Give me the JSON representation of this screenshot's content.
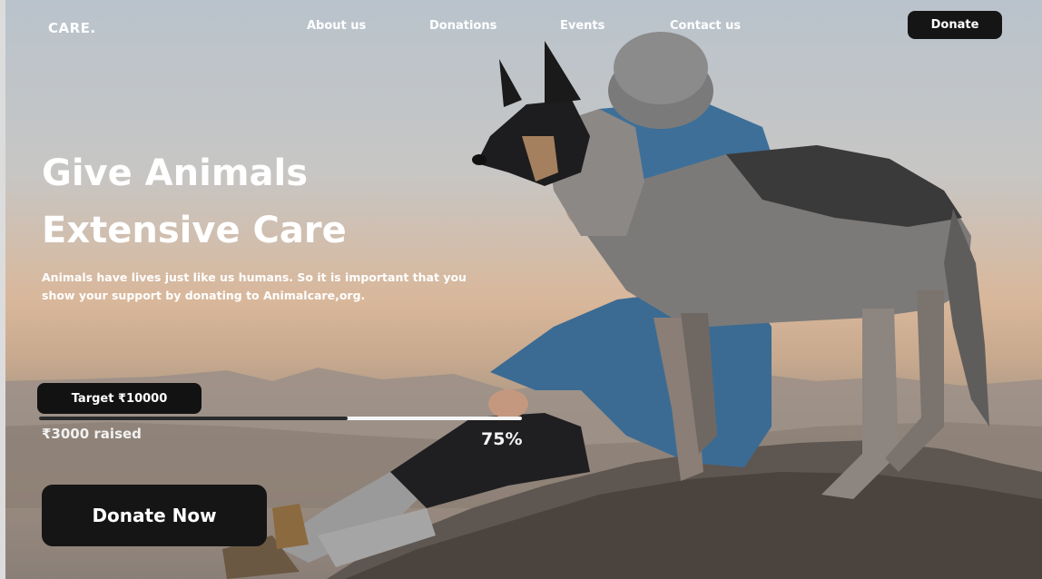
{
  "nav": {
    "logo": "CARE.",
    "links": [
      "About us",
      "Donations",
      "Events",
      "Contact us"
    ],
    "donate_label": "Donate"
  },
  "hero": {
    "title_line1": "Give Animals",
    "title_line2": "Extensive Care",
    "subtitle": "Animals have lives just like us humans. So it is important that you show your support by donating to Animalcare,org."
  },
  "fundraiser": {
    "target_label": "Target  ₹10000",
    "raised_label": "₹3000 raised",
    "progress_fraction": 0.64,
    "percent_label": "75%"
  },
  "cta": {
    "label": "Donate Now"
  },
  "colors": {
    "button_bg": "#151515",
    "text": "#ffffff"
  }
}
